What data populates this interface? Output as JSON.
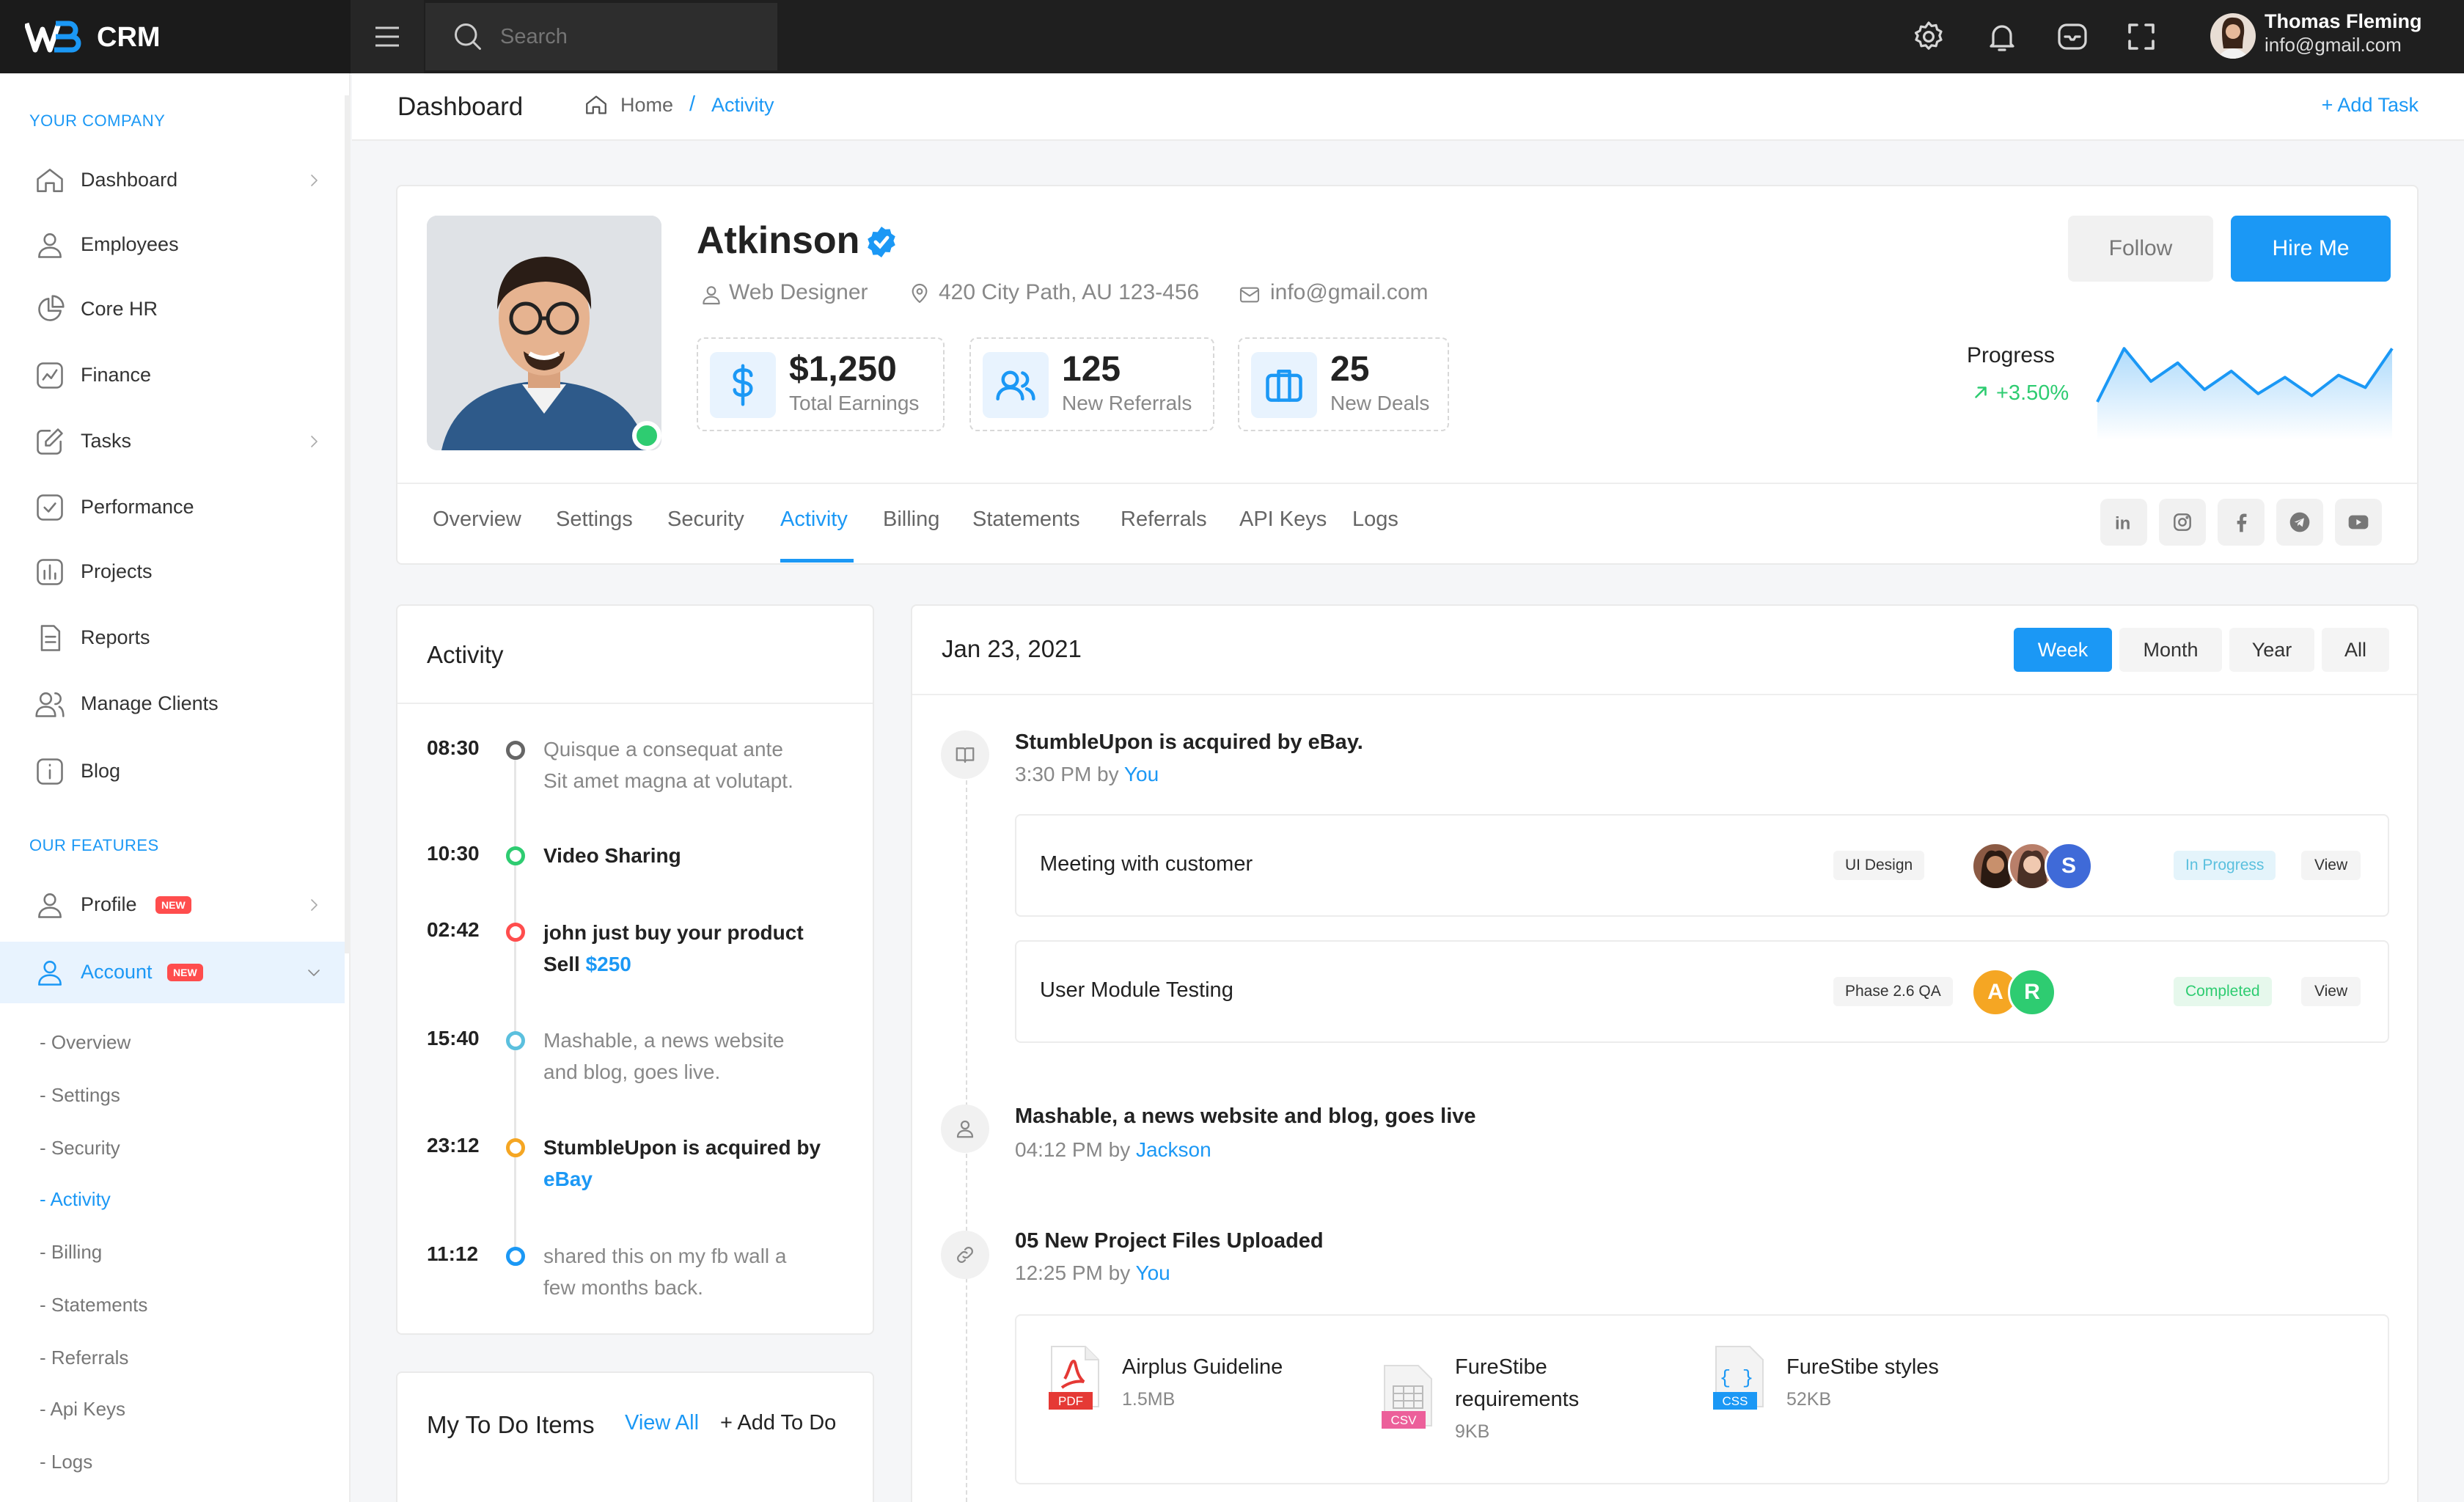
{
  "app": {
    "name": "CRM",
    "logo_text": "WB"
  },
  "search": {
    "placeholder": "Search"
  },
  "user": {
    "name": "Thomas Fleming",
    "email": "info@gmail.com"
  },
  "sidebar": {
    "section1": "YOUR COMPANY",
    "items": [
      {
        "label": "Dashboard",
        "icon": "home-icon"
      },
      {
        "label": "Employees",
        "icon": "user-icon"
      },
      {
        "label": "Core HR",
        "icon": "pie-chart-icon"
      },
      {
        "label": "Finance",
        "icon": "chart-icon"
      },
      {
        "label": "Tasks",
        "icon": "edit-icon"
      },
      {
        "label": "Performance",
        "icon": "check-square-icon"
      },
      {
        "label": "Projects",
        "icon": "bar-chart-icon"
      },
      {
        "label": "Reports",
        "icon": "file-icon"
      },
      {
        "label": "Manage Clients",
        "icon": "users-icon"
      },
      {
        "label": "Blog",
        "icon": "info-icon"
      }
    ],
    "section2": "OUR FEATURES",
    "features": [
      {
        "label": "Profile",
        "badge": "NEW"
      },
      {
        "label": "Account",
        "badge": "NEW"
      }
    ],
    "sub_items": [
      "- Overview",
      "- Settings",
      "- Security",
      "- Activity",
      "- Billing",
      "- Statements",
      "- Referrals",
      "- Api Keys",
      "- Logs"
    ]
  },
  "breadcrumb": {
    "page_title": "Dashboard",
    "home": "Home",
    "separator": "/",
    "current": "Activity",
    "action": "+ Add Task"
  },
  "profile": {
    "name": "Atkinson",
    "role": "Web Designer",
    "address": "420 City Path, AU 123-456",
    "email": "info@gmail.com",
    "stats": [
      {
        "value": "$1,250",
        "label": "Total Earnings"
      },
      {
        "value": "125",
        "label": "New Referrals"
      },
      {
        "value": "25",
        "label": "New Deals"
      }
    ],
    "follow_label": "Follow",
    "hire_label": "Hire Me",
    "progress_label": "Progress",
    "progress_change": "+3.50%",
    "sparkline": [
      30,
      82,
      50,
      68,
      42,
      60,
      38,
      54,
      36,
      56,
      44,
      82
    ]
  },
  "tabs": [
    "Overview",
    "Settings",
    "Security",
    "Activity",
    "Billing",
    "Statements",
    "Referrals",
    "API Keys",
    "Logs"
  ],
  "active_tab": "Activity",
  "socials": [
    "linkedin-icon",
    "instagram-icon",
    "facebook-icon",
    "telegram-icon",
    "youtube-icon"
  ],
  "activity": {
    "title": "Activity",
    "entries": [
      {
        "time": "08:30",
        "line1": "Quisque a consequat ante",
        "line2": "Sit amet magna at volutapt.",
        "color": "#666666"
      },
      {
        "time": "10:30",
        "line1": "Video Sharing",
        "color": "#2ecc71"
      },
      {
        "time": "02:42",
        "line1": "john just buy your product",
        "line2": "Sell ",
        "amount": "$250",
        "color": "#ff4d4d"
      },
      {
        "time": "15:40",
        "line1": "Mashable, a news website",
        "line2": "and blog, goes live.",
        "color": "#5bc0de"
      },
      {
        "time": "23:12",
        "line1": "StumbleUpon is acquired by",
        "line2": "eBay",
        "color": "#f5a623"
      },
      {
        "time": "11:12",
        "line1": "shared this on my fb wall a",
        "line2": "few months back.",
        "color": "#1b98f5"
      }
    ]
  },
  "todo": {
    "title": "My To Do Items",
    "view_all": "View All",
    "add": "+ Add To Do"
  },
  "feed": {
    "date": "Jan 23, 2021",
    "periods": [
      "Week",
      "Month",
      "Year",
      "All"
    ],
    "active_period": "Week",
    "items": [
      {
        "title": "StumbleUpon is acquired by eBay.",
        "time": "3:30 PM by ",
        "author": "You"
      },
      {
        "title": "Mashable, a news website and blog, goes live",
        "time": "04:12 PM by ",
        "author": "Jackson"
      },
      {
        "title": "05 New Project Files Uploaded",
        "time": "12:25 PM by ",
        "author": "You"
      }
    ],
    "tasks": [
      {
        "title": "Meeting with customer",
        "tag": "UI Design",
        "status": "In Progress",
        "view": "View",
        "avatar_letter": "S"
      },
      {
        "title": "User Module Testing",
        "tag": "Phase 2.6 QA",
        "status": "Completed",
        "view": "View",
        "avatars": [
          "A",
          "R"
        ]
      }
    ],
    "files": [
      {
        "name": "Airplus Guideline",
        "size": "1.5MB",
        "type": "PDF"
      },
      {
        "name": "FureStibe requirements",
        "size": "9KB",
        "type": "CSV"
      },
      {
        "name": "FureStibe styles",
        "size": "52KB",
        "type": "CSS"
      }
    ]
  },
  "colors": {
    "accent": "#1b98f5",
    "success": "#2ecc71",
    "danger": "#ff4d4d",
    "topbar": "#1f1f1f"
  }
}
